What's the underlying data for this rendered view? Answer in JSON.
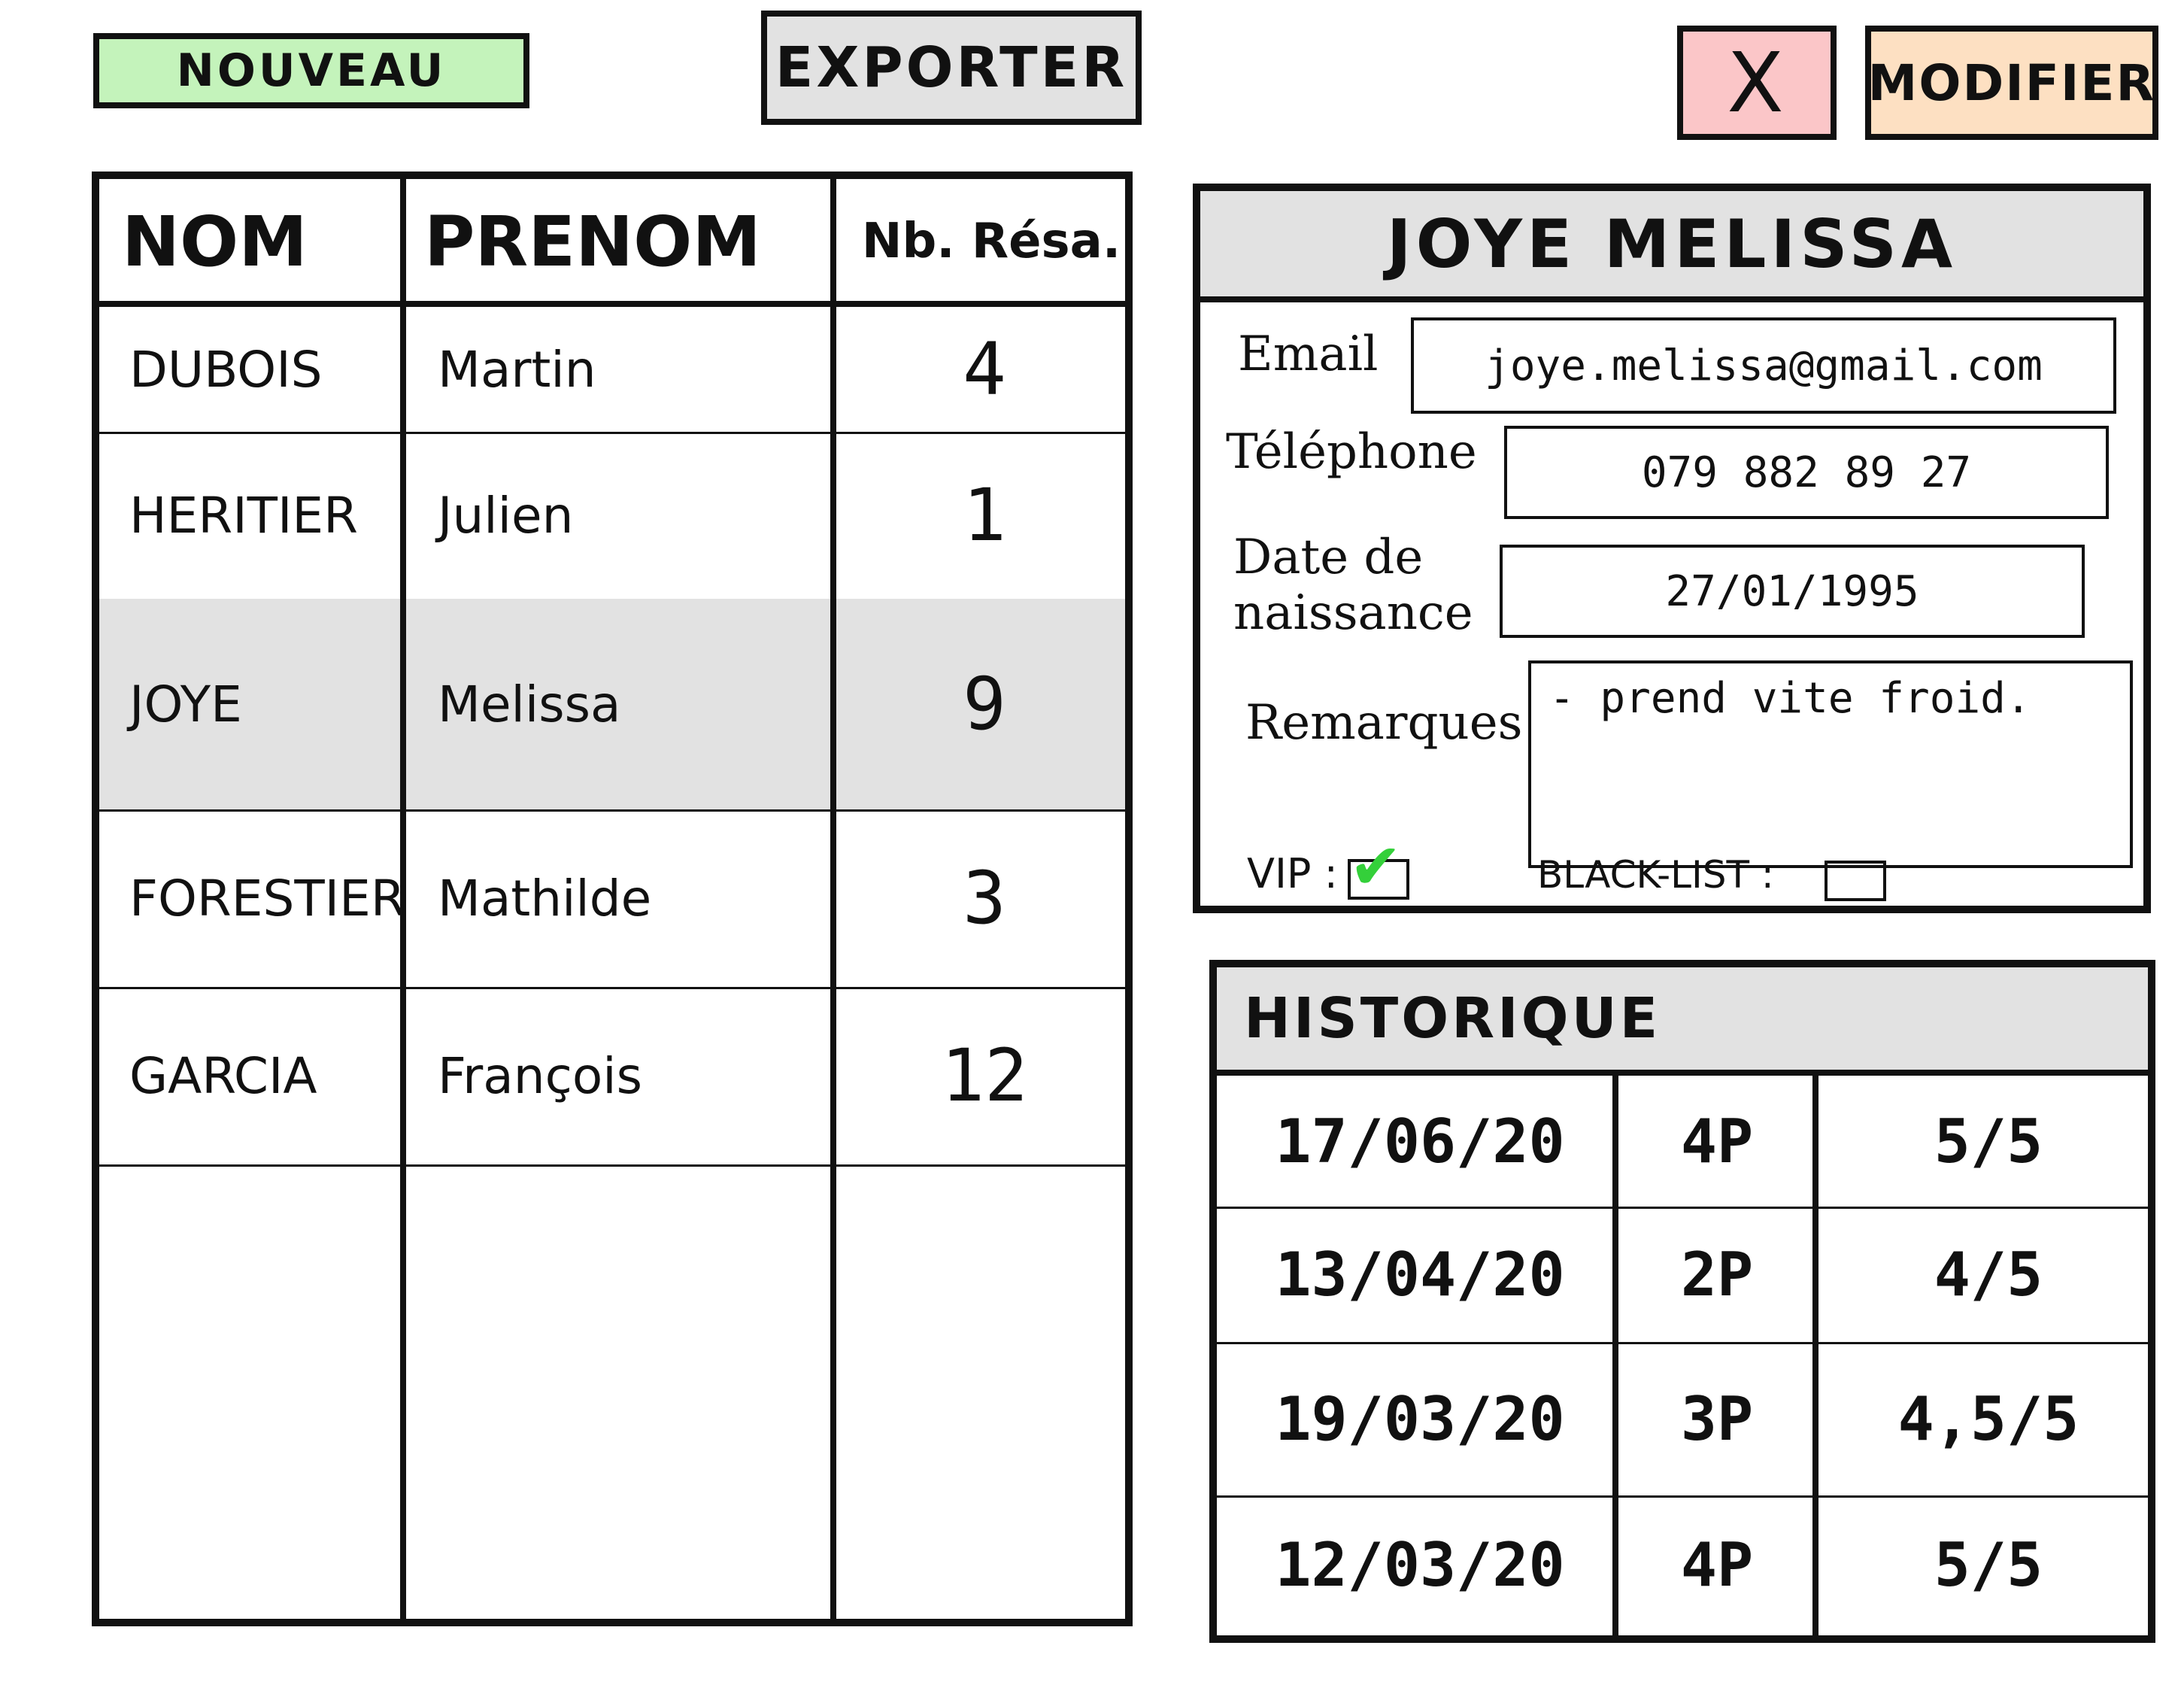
{
  "toolbar": {
    "new_label": "NOUVEAU",
    "export_label": "EXPORTER",
    "close_label": "X",
    "edit_label": "MODIFIER"
  },
  "clients": {
    "columns": [
      "NOM",
      "PRENOM",
      "Nb. Résa."
    ],
    "rows": [
      {
        "nom": "DUBOIS",
        "prenom": "Martin",
        "nb": "4",
        "selected": false
      },
      {
        "nom": "HERITIER",
        "prenom": "Julien",
        "nb": "1",
        "selected": false
      },
      {
        "nom": "JOYE",
        "prenom": "Melissa",
        "nb": "9",
        "selected": true
      },
      {
        "nom": "FORESTIER",
        "prenom": "Mathilde",
        "nb": "3",
        "selected": false
      },
      {
        "nom": "GARCIA",
        "prenom": "François",
        "nb": "12",
        "selected": false
      }
    ]
  },
  "detail": {
    "title": "JOYE MELISSA",
    "email_label": "Email",
    "email": "joye.melissa@gmail.com",
    "phone_label": "Téléphone",
    "phone": "079 882 89 27",
    "birth_label_1": "Date de",
    "birth_label_2": "naissance",
    "birth": "27/01/1995",
    "remarks_label": "Remarques",
    "remarks": "- prend vite froid.",
    "vip_label": "VIP :",
    "vip_checked": true,
    "blacklist_label": "BLACK-LIST :",
    "blacklist_checked": false
  },
  "history": {
    "title": "HISTORIQUE",
    "rows": [
      {
        "date": "17/06/20",
        "people": "4P",
        "rating": "5/5"
      },
      {
        "date": "13/04/20",
        "people": "2P",
        "rating": "4/5"
      },
      {
        "date": "19/03/20",
        "people": "3P",
        "rating": "4,5/5"
      },
      {
        "date": "12/03/20",
        "people": "4P",
        "rating": "5/5"
      }
    ]
  },
  "colors": {
    "new_bg": "#c4f3bb",
    "export_bg": "#e2e2e2",
    "close_bg": "#fbc6c8",
    "edit_bg": "#fde0c2",
    "selected_row_bg": "#e2e2e2",
    "check_color": "#34d03a"
  }
}
